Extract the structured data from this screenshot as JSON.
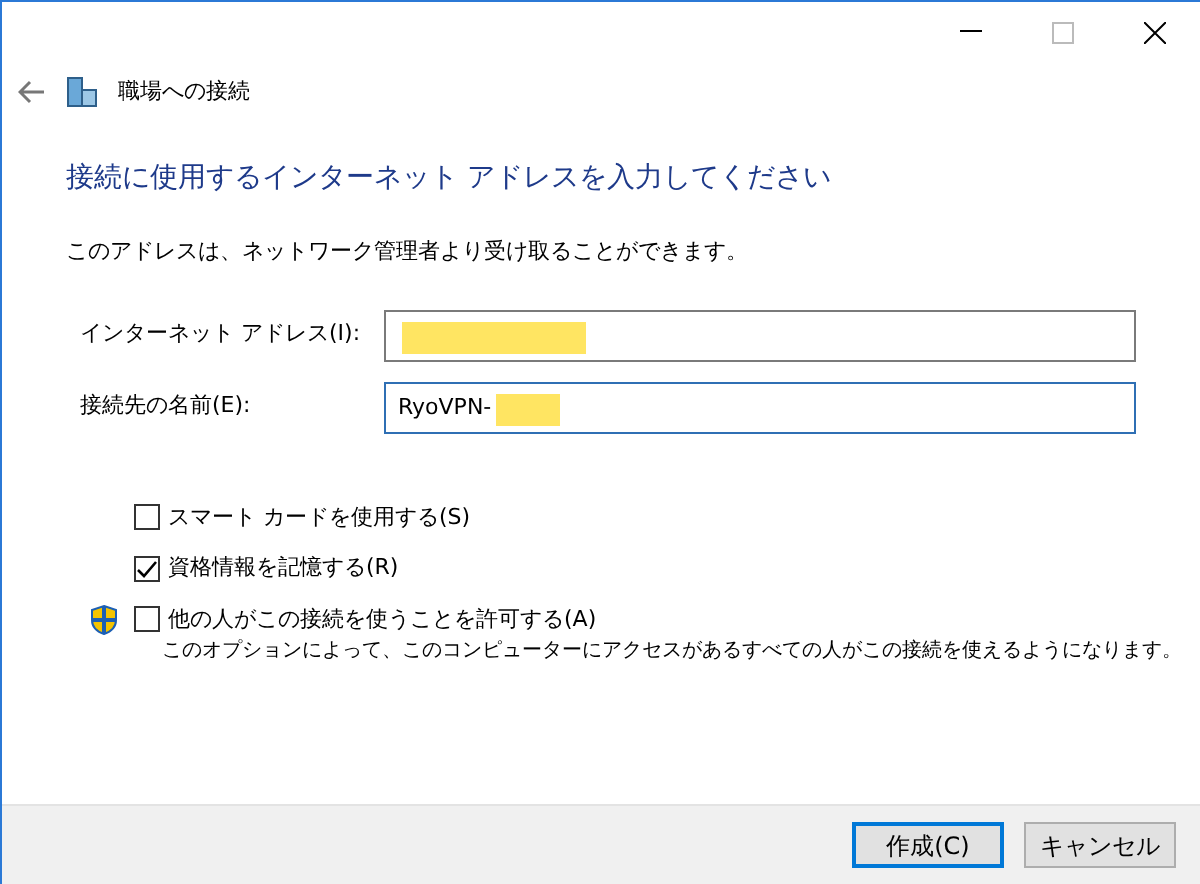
{
  "window": {
    "title": "職場への接続"
  },
  "heading": "接続に使用するインターネット アドレスを入力してください",
  "description": "このアドレスは、ネットワーク管理者より受け取ることができます。",
  "fields": [
    {
      "label": "インターネット アドレス(I):",
      "redacted": true,
      "focused": false
    },
    {
      "label": "接続先の名前(E):",
      "value": "RyoVPN-",
      "redacted": true,
      "focused": true
    }
  ],
  "options": [
    {
      "label": "スマート カードを使用する(S)",
      "checked": false,
      "shield": false
    },
    {
      "label": "資格情報を記憶する(R)",
      "checked": true,
      "shield": false
    },
    {
      "label": "他の人がこの接続を使うことを許可する(A)",
      "checked": false,
      "shield": true,
      "note": "このオプションによって、このコンピューターにアクセスがあるすべての人がこの接続を使えるようになります。"
    }
  ],
  "buttons": [
    {
      "label": "作成(C)",
      "default": true
    },
    {
      "label": "キャンセル",
      "default": false
    }
  ]
}
